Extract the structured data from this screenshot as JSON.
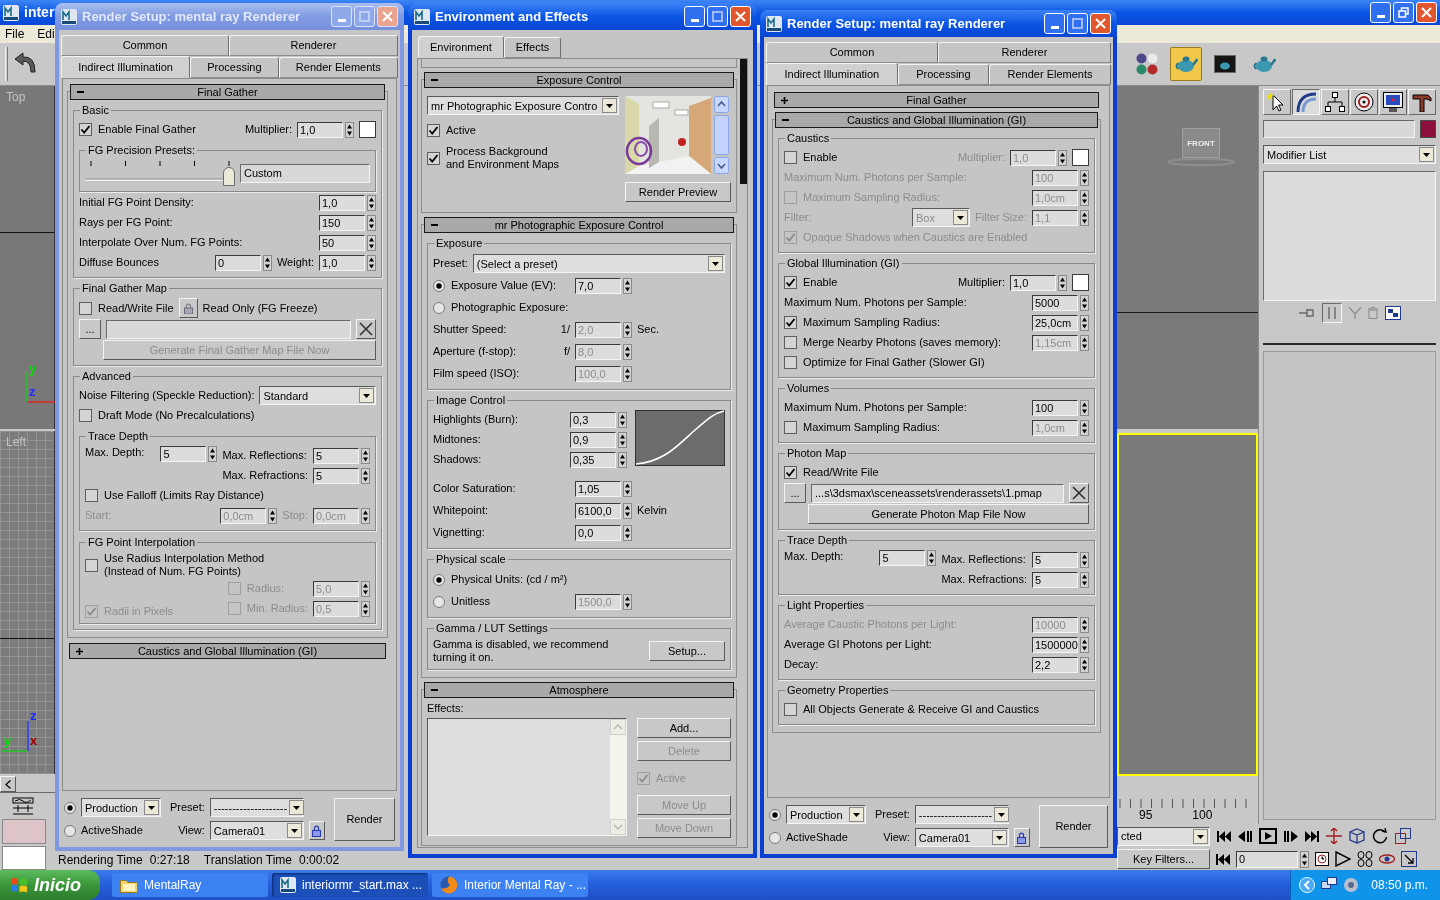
{
  "app": {
    "title": "inter",
    "menu": [
      "File",
      "Edi"
    ],
    "toolbar": [
      {
        "selected": false
      },
      {
        "selected": true
      },
      {
        "selected": false
      },
      {
        "selected": false
      }
    ],
    "viewports": [
      {
        "kind": "plain",
        "label": "Top",
        "axes": [
          {
            "label": "y",
            "color": "#00e000"
          },
          {
            "label": "z",
            "color": "#1a2cff"
          }
        ]
      },
      {
        "kind": "grid",
        "label": "Left",
        "axes": [
          {
            "label": "z",
            "color": "#1a2cff"
          },
          {
            "label": "y",
            "color": "#00e000"
          },
          {
            "label": "x",
            "color": "#a00000"
          }
        ]
      }
    ],
    "viewcube": "FRONT",
    "command_panel": {
      "tabs": [
        {
          "selected": false
        },
        {
          "selected": true
        },
        {
          "selected": false
        },
        {
          "selected": false
        },
        {
          "selected": false
        },
        {
          "selected": false
        }
      ],
      "modifier_list": "Modifier List"
    },
    "timeline": [
      "95",
      "100"
    ],
    "selection": "cted",
    "key_filters": "Key Filters...",
    "frame": "0",
    "status": [
      {
        "label": "Rendering Time",
        "value": "0:27:18"
      },
      {
        "label": "Translation Time",
        "value": "0:00:02"
      }
    ]
  },
  "windows": [
    {
      "kind": "render_setup",
      "title": "Render Setup: mental ray Renderer",
      "active": false,
      "tabs": [
        [
          {
            "label": "Common",
            "selected": false
          },
          {
            "label": "Renderer",
            "selected": false
          }
        ],
        [
          {
            "label": "Indirect Illumination",
            "selected": true
          },
          {
            "label": "Processing",
            "selected": false
          },
          {
            "label": "Render Elements",
            "selected": false
          }
        ]
      ],
      "rollouts": [
        {
          "title": "Final Gather",
          "expanded": true,
          "groups": [
            {
              "title": "Basic",
              "items": [
                [
                  {
                    "kind": "check",
                    "label": "Enable Final Gather",
                    "checked": true,
                    "disabled": false
                  },
                  {
                    "kind": "text",
                    "text": "Multiplier:",
                    "disabled": false
                  },
                  {
                    "kind": "spin",
                    "value": "1,0",
                    "disabled": false
                  },
                  {
                    "kind": "swatch"
                  }
                ],
                {
                  "title": "FG Precision Presets:",
                  "items": [
                    [
                      {
                        "kind": "slider",
                        "level": 1
                      },
                      {
                        "kind": "field",
                        "value": "Custom"
                      }
                    ]
                  ]
                },
                [
                  {
                    "kind": "text",
                    "text": "Initial FG Point Density:",
                    "disabled": false
                  },
                  {
                    "kind": "spin",
                    "value": "1,0",
                    "disabled": false
                  }
                ],
                [
                  {
                    "kind": "text",
                    "text": "Rays per FG Point:",
                    "disabled": false
                  },
                  {
                    "kind": "spin",
                    "value": "150",
                    "disabled": false
                  }
                ],
                [
                  {
                    "kind": "text",
                    "text": "Interpolate Over Num. FG Points:",
                    "disabled": false
                  },
                  {
                    "kind": "spin",
                    "value": "50",
                    "disabled": false
                  }
                ],
                [
                  {
                    "kind": "text",
                    "text": "Diffuse Bounces",
                    "disabled": false
                  },
                  {
                    "kind": "spin",
                    "value": "0",
                    "disabled": false
                  },
                  {
                    "kind": "text",
                    "text": "Weight:",
                    "disabled": false
                  },
                  {
                    "kind": "spin",
                    "value": "1,0",
                    "disabled": false
                  }
                ]
              ]
            },
            {
              "title": "Final Gather Map",
              "items": [
                [
                  {
                    "kind": "check",
                    "label": "Read/Write File",
                    "checked": false,
                    "disabled": false
                  },
                  {
                    "kind": "lock"
                  },
                  {
                    "kind": "text",
                    "text": "Read Only (FG Freeze)",
                    "disabled": false
                  }
                ],
                [
                  {
                    "kind": "button",
                    "label": "...",
                    "disabled": false
                  },
                  {
                    "kind": "field"
                  },
                  {
                    "kind": "clear"
                  }
                ],
                [
                  {
                    "kind": "button",
                    "label": "Generate Final Gather Map File Now",
                    "disabled": true
                  }
                ]
              ]
            },
            {
              "title": "Advanced",
              "items": [
                [
                  {
                    "kind": "text",
                    "text": "Noise Filtering (Speckle Reduction):",
                    "disabled": false
                  },
                  {
                    "kind": "dropdown",
                    "value": "Standard",
                    "disabled": false
                  }
                ],
                [
                  {
                    "kind": "check",
                    "label": "Draft Mode (No Precalculations)",
                    "checked": false,
                    "disabled": false
                  }
                ],
                {
                  "title": "Trace Depth",
                  "items": [
                    [
                      {
                        "kind": "text",
                        "text": "Max. Depth:",
                        "disabled": false
                      },
                      {
                        "kind": "spin",
                        "value": "5",
                        "disabled": false
                      },
                      {
                        "kind": "stack",
                        "rows": [
                          [
                            {
                              "kind": "text",
                              "text": "Max. Reflections:",
                              "disabled": false
                            },
                            {
                              "kind": "spin",
                              "value": "5",
                              "disabled": false
                            }
                          ],
                          [
                            {
                              "kind": "text",
                              "text": "Max. Refractions:",
                              "disabled": false
                            },
                            {
                              "kind": "spin",
                              "value": "5",
                              "disabled": false
                            }
                          ]
                        ]
                      }
                    ],
                    [
                      {
                        "kind": "check",
                        "label": "Use Falloff (Limits Ray Distance)",
                        "checked": false,
                        "disabled": false
                      }
                    ],
                    [
                      {
                        "kind": "text",
                        "text": "Start:",
                        "disabled": true
                      },
                      {
                        "kind": "spin",
                        "value": "0,0cm",
                        "disabled": true
                      },
                      {
                        "kind": "text",
                        "text": "Stop:",
                        "disabled": true
                      },
                      {
                        "kind": "spin",
                        "value": "0,0cm",
                        "disabled": true
                      }
                    ]
                  ]
                },
                {
                  "title": "FG Point Interpolation",
                  "items": [
                    [
                      {
                        "kind": "check",
                        "lines": [
                          "Use Radius Interpolation Method",
                          "(Instead of Num. FG Points)"
                        ],
                        "checked": false,
                        "disabled": false
                      }
                    ],
                    [
                      {
                        "kind": "check",
                        "label": "Radii in Pixels",
                        "checked": true,
                        "disabled": true
                      },
                      {
                        "kind": "stack",
                        "rows": [
                          [
                            {
                              "kind": "check",
                              "label": "Radius:",
                              "checked": false,
                              "disabled": true
                            },
                            {
                              "kind": "spin",
                              "value": "5,0",
                              "disabled": true
                            }
                          ],
                          [
                            {
                              "kind": "check",
                              "label": "Min. Radius:",
                              "checked": false,
                              "disabled": true
                            },
                            {
                              "kind": "spin",
                              "value": "0,5",
                              "disabled": true
                            }
                          ]
                        ]
                      }
                    ]
                  ]
                }
              ]
            }
          ]
        },
        {
          "title": "Caustics and Global Illumination (GI)",
          "expanded": false
        }
      ],
      "footer": {
        "modes": [
          {
            "kind": "dropdown",
            "value": "Production",
            "selected": true
          },
          {
            "kind": "label",
            "label": "ActiveShade",
            "selected": false
          }
        ],
        "preset": {
          "label": "Preset:",
          "value": "--------------------"
        },
        "view": {
          "label": "View:",
          "value": "Camera01"
        },
        "render": "Render"
      }
    },
    {
      "kind": "environment",
      "title": "Environment and Effects",
      "active": true,
      "tabs": [
        [
          {
            "label": "Environment",
            "selected": true
          },
          {
            "label": "Effects",
            "selected": false
          }
        ]
      ],
      "rollouts": [
        {
          "kind": "exposure",
          "title": "Exposure Control",
          "expanded": true,
          "control": "mr Photographic Exposure Contro",
          "checks": [
            {
              "kind": "check",
              "label": "Active",
              "checked": true,
              "disabled": false
            },
            {
              "kind": "check",
              "lines": [
                "Process Background",
                "and Environment Maps"
              ],
              "checked": true,
              "disabled": false
            }
          ],
          "preview_button": "Render Preview"
        },
        {
          "kind": "groups",
          "title": "mr Photographic Exposure Control",
          "expanded": true,
          "groups": [
            {
              "kind": "plain",
              "title": "Exposure",
              "items": [
                [
                  {
                    "kind": "text",
                    "text": "Preset:",
                    "disabled": false
                  },
                  {
                    "kind": "dropdown",
                    "value": "(Select a preset)",
                    "disabled": false
                  }
                ],
                [
                  {
                    "kind": "radio",
                    "label": "Exposure Value (EV):",
                    "selected": true,
                    "disabled": false
                  },
                  {
                    "kind": "spin",
                    "value": "7,0",
                    "disabled": false
                  }
                ],
                [
                  {
                    "kind": "radio",
                    "label": "Photographic Exposure:",
                    "selected": false,
                    "disabled": false
                  }
                ],
                [
                  {
                    "kind": "text",
                    "text": "Shutter Speed:",
                    "disabled": false
                  },
                  {
                    "kind": "text",
                    "text": "1/",
                    "disabled": false
                  },
                  {
                    "kind": "spin",
                    "value": "2,0",
                    "disabled": true
                  },
                  {
                    "kind": "text",
                    "text": "Sec.",
                    "disabled": false
                  }
                ],
                [
                  {
                    "kind": "text",
                    "text": "Aperture (f-stop):",
                    "disabled": false
                  },
                  {
                    "kind": "text",
                    "text": "f/",
                    "disabled": false
                  },
                  {
                    "kind": "spin",
                    "value": "8,0",
                    "disabled": true
                  }
                ],
                [
                  {
                    "kind": "text",
                    "text": "Film speed (ISO):",
                    "disabled": false
                  },
                  {
                    "kind": "spin",
                    "value": "100,0",
                    "disabled": true
                  }
                ]
              ]
            },
            {
              "kind": "curve",
              "title": "Image Control",
              "items": [
                [
                  {
                    "kind": "text",
                    "text": "Highlights (Burn):",
                    "disabled": false
                  },
                  {
                    "kind": "spin",
                    "value": "0,3",
                    "disabled": false
                  }
                ],
                [
                  {
                    "kind": "text",
                    "text": "Midtones:",
                    "disabled": false
                  },
                  {
                    "kind": "spin",
                    "value": "0,9",
                    "disabled": false
                  }
                ],
                [
                  {
                    "kind": "text",
                    "text": "Shadows:",
                    "disabled": false
                  },
                  {
                    "kind": "spin",
                    "value": "0,35",
                    "disabled": false
                  }
                ],
                [
                  {
                    "kind": "text",
                    "text": "Color Saturation:",
                    "disabled": false
                  },
                  {
                    "kind": "spin",
                    "value": "1,05",
                    "disabled": false
                  }
                ],
                [
                  {
                    "kind": "text",
                    "text": "Whitepoint:",
                    "disabled": false
                  },
                  {
                    "kind": "spin",
                    "value": "6100,0",
                    "disabled": false
                  },
                  {
                    "kind": "text",
                    "text": "Kelvin",
                    "disabled": false
                  }
                ],
                [
                  {
                    "kind": "text",
                    "text": "Vignetting:",
                    "disabled": false
                  },
                  {
                    "kind": "spin",
                    "value": "0,0",
                    "disabled": false
                  }
                ]
              ]
            },
            {
              "kind": "plain",
              "title": "Physical scale",
              "items": [
                [
                  {
                    "kind": "radio",
                    "label": "Physical Units: (cd / m²)",
                    "selected": true,
                    "disabled": false
                  }
                ],
                [
                  {
                    "kind": "radio",
                    "label": "Unitless",
                    "selected": false,
                    "disabled": false
                  },
                  {
                    "kind": "spin",
                    "value": "1500,0",
                    "disabled": true
                  }
                ]
              ]
            },
            {
              "kind": "plain",
              "title": "Gamma / LUT Settings",
              "items": [
                [
                  {
                    "kind": "text",
                    "text": "Gamma is disabled, we recommend turning it on.",
                    "disabled": false
                  },
                  {
                    "kind": "button",
                    "label": "Setup...",
                    "disabled": false
                  }
                ]
              ]
            }
          ]
        },
        {
          "kind": "atmosphere",
          "title": "Atmosphere",
          "expanded": true,
          "list_label": "Effects:",
          "side": [
            {
              "kind": "button",
              "label": "Add...",
              "disabled": false
            },
            {
              "kind": "button",
              "label": "Delete",
              "disabled": true
            },
            {
              "kind": "check",
              "label": "Active",
              "checked": true,
              "disabled": true
            },
            {
              "kind": "button",
              "label": "Move Up",
              "disabled": true
            },
            {
              "kind": "button",
              "label": "Move Down",
              "disabled": true
            }
          ]
        }
      ]
    },
    {
      "kind": "render_setup",
      "title": "Render Setup: mental ray Renderer",
      "active": true,
      "tabs": [
        [
          {
            "label": "Common",
            "selected": false
          },
          {
            "label": "Renderer",
            "selected": false
          }
        ],
        [
          {
            "label": "Indirect Illumination",
            "selected": true
          },
          {
            "label": "Processing",
            "selected": false
          },
          {
            "label": "Render Elements",
            "selected": false
          }
        ]
      ],
      "rollouts": [
        {
          "title": "Final Gather",
          "expanded": false
        },
        {
          "title": "Caustics and Global Illumination (GI)",
          "expanded": true,
          "groups": [
            {
              "title": "Caustics",
              "items": [
                [
                  {
                    "kind": "check",
                    "label": "Enable",
                    "checked": false,
                    "disabled": false
                  },
                  {
                    "kind": "text",
                    "text": "Multiplier:",
                    "disabled": true
                  },
                  {
                    "kind": "spin",
                    "value": "1,0",
                    "disabled": true
                  },
                  {
                    "kind": "swatch"
                  }
                ],
                [
                  {
                    "kind": "text",
                    "text": "Maximum Num. Photons per Sample:",
                    "disabled": true
                  },
                  {
                    "kind": "spin",
                    "value": "100",
                    "disabled": true
                  }
                ],
                [
                  {
                    "kind": "check",
                    "label": "Maximum Sampling Radius:",
                    "checked": false,
                    "disabled": true
                  },
                  {
                    "kind": "spin",
                    "value": "1,0cm",
                    "disabled": true
                  }
                ],
                [
                  {
                    "kind": "text",
                    "text": "Filter:",
                    "disabled": true
                  },
                  {
                    "kind": "dropdown",
                    "value": "Box",
                    "disabled": true
                  },
                  {
                    "kind": "text",
                    "text": "Filter Size:",
                    "disabled": true
                  },
                  {
                    "kind": "spin",
                    "value": "1,1",
                    "disabled": true
                  }
                ],
                [
                  {
                    "kind": "check",
                    "label": "Opaque Shadows when Caustics are Enabled",
                    "checked": true,
                    "disabled": true
                  }
                ]
              ]
            },
            {
              "title": "Global Illumination (GI)",
              "items": [
                [
                  {
                    "kind": "check",
                    "label": "Enable",
                    "checked": true,
                    "disabled": false
                  },
                  {
                    "kind": "text",
                    "text": "Multiplier:",
                    "disabled": false
                  },
                  {
                    "kind": "spin",
                    "value": "1,0",
                    "disabled": false
                  },
                  {
                    "kind": "swatch"
                  }
                ],
                [
                  {
                    "kind": "text",
                    "text": "Maximum Num. Photons per Sample:",
                    "disabled": false
                  },
                  {
                    "kind": "spin",
                    "value": "5000",
                    "disabled": false
                  }
                ],
                [
                  {
                    "kind": "check",
                    "label": "Maximum Sampling Radius:",
                    "checked": true,
                    "disabled": false
                  },
                  {
                    "kind": "spin",
                    "value": "25,0cm",
                    "disabled": false
                  }
                ],
                [
                  {
                    "kind": "check",
                    "label": "Merge Nearby Photons (saves memory):",
                    "checked": false,
                    "disabled": false
                  },
                  {
                    "kind": "spin",
                    "value": "1,15cm",
                    "disabled": true
                  }
                ],
                [
                  {
                    "kind": "check",
                    "label": "Optimize for Final Gather (Slower GI)",
                    "checked": false,
                    "disabled": false
                  }
                ]
              ]
            },
            {
              "title": "Volumes",
              "items": [
                [
                  {
                    "kind": "text",
                    "text": "Maximum Num. Photons per Sample:",
                    "disabled": false
                  },
                  {
                    "kind": "spin",
                    "value": "100",
                    "disabled": false
                  }
                ],
                [
                  {
                    "kind": "check",
                    "label": "Maximum Sampling Radius:",
                    "checked": false,
                    "disabled": false
                  },
                  {
                    "kind": "spin",
                    "value": "1,0cm",
                    "disabled": true
                  }
                ]
              ]
            },
            {
              "title": "Photon Map",
              "items": [
                [
                  {
                    "kind": "check",
                    "label": "Read/Write File",
                    "checked": true,
                    "disabled": false
                  }
                ],
                [
                  {
                    "kind": "button",
                    "label": "...",
                    "disabled": false
                  },
                  {
                    "kind": "field",
                    "value": "...s\\3dsmax\\sceneassets\\renderassets\\1.pmap"
                  },
                  {
                    "kind": "clear"
                  }
                ],
                [
                  {
                    "kind": "button",
                    "label": "Generate Photon Map File Now",
                    "disabled": false
                  }
                ]
              ]
            },
            {
              "title": "Trace Depth",
              "items": [
                [
                  {
                    "kind": "text",
                    "text": "Max. Depth:",
                    "disabled": false
                  },
                  {
                    "kind": "spin",
                    "value": "5",
                    "disabled": false
                  },
                  {
                    "kind": "stack",
                    "rows": [
                      [
                        {
                          "kind": "text",
                          "text": "Max. Reflections:",
                          "disabled": false
                        },
                        {
                          "kind": "spin",
                          "value": "5",
                          "disabled": false
                        }
                      ],
                      [
                        {
                          "kind": "text",
                          "text": "Max. Refractions:",
                          "disabled": false
                        },
                        {
                          "kind": "spin",
                          "value": "5",
                          "disabled": false
                        }
                      ]
                    ]
                  }
                ]
              ]
            },
            {
              "title": "Light Properties",
              "items": [
                [
                  {
                    "kind": "text",
                    "text": "Average Caustic Photons per Light:",
                    "disabled": true
                  },
                  {
                    "kind": "spin",
                    "value": "10000",
                    "disabled": true
                  }
                ],
                [
                  {
                    "kind": "text",
                    "text": "Average GI Photons per Light:",
                    "disabled": false
                  },
                  {
                    "kind": "spin",
                    "value": "1500000",
                    "disabled": false
                  }
                ],
                [
                  {
                    "kind": "text",
                    "text": "Decay:",
                    "disabled": false
                  },
                  {
                    "kind": "spin",
                    "value": "2,2",
                    "disabled": false
                  }
                ]
              ]
            },
            {
              "title": "Geometry Properties",
              "items": [
                [
                  {
                    "kind": "check",
                    "label": "All Objects Generate & Receive GI and Caustics",
                    "checked": false,
                    "disabled": false
                  }
                ]
              ]
            }
          ]
        }
      ],
      "footer": {
        "modes": [
          {
            "kind": "dropdown",
            "value": "Production",
            "selected": true
          },
          {
            "kind": "label",
            "label": "ActiveShade",
            "selected": false
          }
        ],
        "preset": {
          "label": "Preset:",
          "value": "--------------------"
        },
        "view": {
          "label": "View:",
          "value": "Camera01"
        },
        "render": "Render"
      }
    }
  ],
  "taskbar": {
    "start": "Inicio",
    "tasks": [
      {
        "kind": "folder",
        "label": "MentalRay",
        "selected": false
      },
      {
        "kind": "max",
        "label": "interiormr_start.max ...",
        "selected": true
      },
      {
        "kind": "browser",
        "label": "Interior Mental Ray - ...",
        "selected": false
      }
    ],
    "clock": "08:50 p.m."
  }
}
